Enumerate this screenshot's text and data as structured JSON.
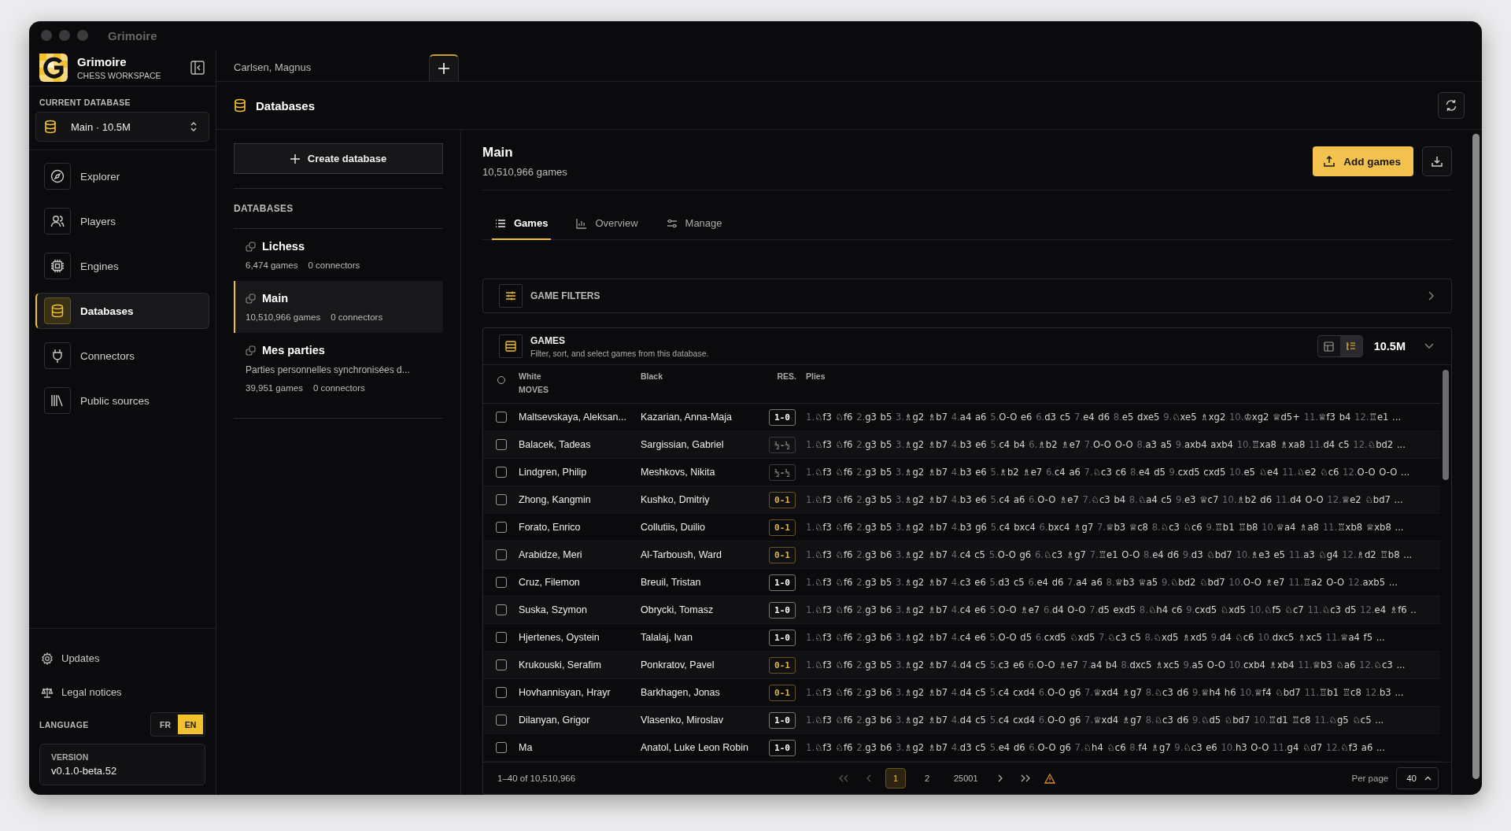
{
  "window": {
    "title": "Grimoire"
  },
  "sidebar": {
    "app_name": "Grimoire",
    "app_subtitle": "CHESS WORKSPACE",
    "current_database_label": "CURRENT DATABASE",
    "current_database": "Main · 10.5M",
    "nav": [
      {
        "label": "Explorer",
        "selected": false
      },
      {
        "label": "Players",
        "selected": false
      },
      {
        "label": "Engines",
        "selected": false
      },
      {
        "label": "Databases",
        "selected": true
      },
      {
        "label": "Connectors",
        "selected": false
      },
      {
        "label": "Public sources",
        "selected": false
      }
    ],
    "footer_links": [
      "Updates",
      "Legal notices"
    ],
    "language_label": "LANGUAGE",
    "languages": [
      {
        "label": "FR",
        "selected": false
      },
      {
        "label": "EN",
        "selected": true
      }
    ],
    "version_label": "VERSION",
    "version": "v0.1.0-beta.52"
  },
  "tabs": [
    {
      "label": "Carlsen, Magnus"
    }
  ],
  "page_title": "Databases",
  "database_panel": {
    "create_button": "Create database",
    "heading": "DATABASES",
    "items": [
      {
        "name": "Lichess",
        "games": "6,474 games",
        "connectors": "0 connectors",
        "selected": false
      },
      {
        "name": "Main",
        "games": "10,510,966 games",
        "connectors": "0 connectors",
        "selected": true
      },
      {
        "name": "Mes parties",
        "description": "Parties personnelles synchronisées d...",
        "games": "39,951 games",
        "connectors": "0 connectors",
        "selected": false
      }
    ]
  },
  "main": {
    "title": "Main",
    "subtitle": "10,510,966 games",
    "add_button": "Add games",
    "tabs": [
      {
        "label": "Games",
        "selected": true
      },
      {
        "label": "Overview",
        "selected": false
      },
      {
        "label": "Manage",
        "selected": false
      }
    ],
    "filters": {
      "title": "GAME FILTERS"
    },
    "games": {
      "title": "GAMES",
      "description": "Filter, sort, and select games from this database.",
      "count": "10.5M",
      "view_modes": [
        {
          "kind": "table",
          "selected": false
        },
        {
          "kind": "tree",
          "selected": true
        }
      ],
      "select_all": {
        "checked": false
      },
      "columns": {
        "white": "White",
        "moves": "MOVES",
        "black": "Black",
        "result": "RES.",
        "plies": "Plies"
      },
      "rows": [
        {
          "checked": false,
          "white": "Maltsevskaya, Aleksan...",
          "black": "Kazarian, Anna-Maja",
          "result": "1-0",
          "kind": "white",
          "moves": "1.♘f3 ♘f6 2.g3 b5 3.♗g2 ♗b7 4.a4 a6 5.O-O e6 6.d3 c5 7.e4 d6 8.e5 dxe5 9.♘xe5 ♗xg2 10.♔xg2 ♕d5+ 11.♕f3 b4 12.♖e1 ..."
        },
        {
          "checked": false,
          "white": "Balacek, Tadeas",
          "black": "Sargissian, Gabriel",
          "result": "½-½",
          "kind": "draw",
          "moves": "1.♘f3 ♘f6 2.g3 b5 3.♗g2 ♗b7 4.b3 e6 5.c4 b4 6.♗b2 ♗e7 7.O-O O-O 8.a3 a5 9.axb4 axb4 10.♖xa8 ♗xa8 11.d4 c5 12.♘bd2 ..."
        },
        {
          "checked": false,
          "white": "Lindgren, Philip",
          "black": "Meshkovs, Nikita",
          "result": "½-½",
          "kind": "draw",
          "moves": "1.♘f3 ♘f6 2.g3 b5 3.♗g2 ♗b7 4.b3 e6 5.♗b2 ♗e7 6.c4 a6 7.♘c3 c6 8.e4 d5 9.cxd5 cxd5 10.e5 ♘e4 11.♘e2 ♘c6 12.O-O O-O ..."
        },
        {
          "checked": false,
          "white": "Zhong, Kangmin",
          "black": "Kushko, Dmitriy",
          "result": "0-1",
          "kind": "black",
          "moves": "1.♘f3 ♘f6 2.g3 b5 3.♗g2 ♗b7 4.b3 e6 5.c4 a6 6.O-O ♗e7 7.♘c3 b4 8.♘a4 c5 9.e3 ♕c7 10.♗b2 d6 11.d4 O-O 12.♕e2 ♘bd7 ..."
        },
        {
          "checked": false,
          "white": "Forato, Enrico",
          "black": "Collutiis, Duilio",
          "result": "0-1",
          "kind": "black",
          "moves": "1.♘f3 ♘f6 2.g3 b5 3.♗g2 ♗b7 4.b3 g6 5.c4 bxc4 6.bxc4 ♗g7 7.♕b3 ♕c8 8.♘c3 ♘c6 9.♖b1 ♖b8 10.♕a4 ♗a8 11.♖xb8 ♕xb8 ..."
        },
        {
          "checked": false,
          "white": "Arabidze, Meri",
          "black": "Al-Tarboush, Ward",
          "result": "0-1",
          "kind": "black",
          "moves": "1.♘f3 ♘f6 2.g3 b6 3.♗g2 ♗b7 4.c4 c5 5.O-O g6 6.♘c3 ♗g7 7.♖e1 O-O 8.e4 d6 9.d3 ♘bd7 10.♗e3 e5 11.a3 ♘g4 12.♗d2 ♖b8 ..."
        },
        {
          "checked": false,
          "white": "Cruz, Filemon",
          "black": "Breuil, Tristan",
          "result": "1-0",
          "kind": "white",
          "moves": "1.♘f3 ♘f6 2.g3 b5 3.♗g2 ♗b7 4.c3 e6 5.d3 c5 6.e4 d6 7.a4 a6 8.♕b3 ♕a5 9.♘bd2 ♘bd7 10.O-O ♗e7 11.♖a2 O-O 12.axb5 ..."
        },
        {
          "checked": false,
          "white": "Suska, Szymon",
          "black": "Obrycki, Tomasz",
          "result": "1-0",
          "kind": "white",
          "moves": "1.♘f3 ♘f6 2.g3 b6 3.♗g2 ♗b7 4.c4 e6 5.O-O ♗e7 6.d4 O-O 7.d5 exd5 8.♘h4 c6 9.cxd5 ♘xd5 10.♘f5 ♘c7 11.♘c3 d5 12.e4 ♗f6 .."
        },
        {
          "checked": false,
          "white": "Hjertenes, Oystein",
          "black": "Talalaj, Ivan",
          "result": "1-0",
          "kind": "white",
          "moves": "1.♘f3 ♘f6 2.g3 b6 3.♗g2 ♗b7 4.c4 e6 5.O-O d5 6.cxd5 ♘xd5 7.♘c3 c5 8.♘xd5 ♗xd5 9.d4 ♘c6 10.dxc5 ♗xc5 11.♕a4 f5 ..."
        },
        {
          "checked": false,
          "white": "Krukouski, Serafim",
          "black": "Ponkratov, Pavel",
          "result": "0-1",
          "kind": "black",
          "moves": "1.♘f3 ♘f6 2.g3 b5 3.♗g2 ♗b7 4.d4 c5 5.c3 e6 6.O-O ♗e7 7.a4 b4 8.dxc5 ♗xc5 9.a5 O-O 10.cxb4 ♗xb4 11.♕b3 ♘a6 12.♘c3 ..."
        },
        {
          "checked": false,
          "white": "Hovhannisyan, Hrayr",
          "black": "Barkhagen, Jonas",
          "result": "0-1",
          "kind": "black",
          "moves": "1.♘f3 ♘f6 2.g3 b6 3.♗g2 ♗b7 4.d4 c5 5.c4 cxd4 6.O-O g6 7.♕xd4 ♗g7 8.♘c3 d6 9.♕h4 h6 10.♕f4 ♘bd7 11.♖b1 ♖c8 12.b3 ..."
        },
        {
          "checked": false,
          "white": "Dilanyan, Grigor",
          "black": "Vlasenko, Miroslav",
          "result": "1-0",
          "kind": "white",
          "moves": "1.♘f3 ♘f6 2.g3 b6 3.♗g2 ♗b7 4.d4 c5 5.c4 cxd4 6.O-O g6 7.♕xd4 ♗g7 8.♘c3 d6 9.♘d5 ♘bd7 10.♖d1 ♖c8 11.♘g5 ♘c5 ..."
        },
        {
          "checked": false,
          "white": "Ma",
          "black": "Anatol, Luke Leon Robin",
          "result": "1-0",
          "kind": "white",
          "moves": "1.♘f3 ♘f6 2.g3 b6 3.♗g2 ♗b7 4.d3 c5 5.e4 d6 6.O-O g6 7.♘h4 ♘c6 8.f4 ♗g7 9.♘c3 e6 10.h3 O-O 11.g4 ♘d7 12.♘f3 a6 ..."
        }
      ],
      "footer": {
        "range": "1–40 of 10,510,966",
        "pages": [
          {
            "label": "1",
            "selected": true
          },
          {
            "label": "2",
            "selected": false
          },
          {
            "label": "25001",
            "selected": false
          }
        ],
        "per_page_label": "Per page",
        "per_page": "40"
      }
    }
  }
}
